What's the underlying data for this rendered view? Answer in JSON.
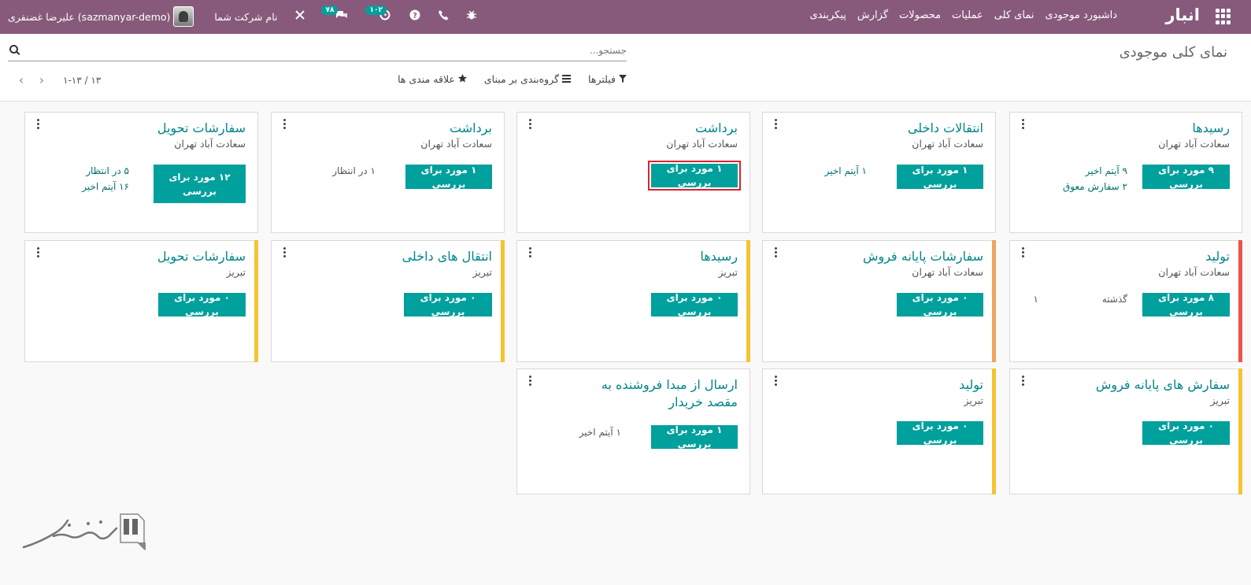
{
  "navbar": {
    "brand": "انبار",
    "menu": [
      "داشبورد موجودی",
      "نمای کلی",
      "عملیات",
      "محصولات",
      "گزارش",
      "پیکربندی"
    ],
    "user_name": "علیرضا غضنفری (sazmanyar-demo)",
    "company": "نام شرکت شما",
    "activity_count": "۱۰۲",
    "messages_count": "۷۸"
  },
  "control": {
    "breadcrumb": "نمای کلی موجودی",
    "search_placeholder": "جستجو...",
    "filters_label": "فیلترها",
    "groupby_label": "گروه‌بندی بر مبنای",
    "favorites_label": "علاقه مندی ها",
    "pager_value": "۱-۱۳ / ۱۳"
  },
  "cards": [
    {
      "title": "رسیدها",
      "subtitle": "سعادت آباد تهران",
      "button": "۹ مورد برای بررسی",
      "stats": [
        "۹ آیتم اخیر",
        "۲ سفارش معوق"
      ],
      "stripe": ""
    },
    {
      "title": "انتقالات داخلی",
      "subtitle": "سعادت آباد تهران",
      "button": "۱ مورد برای بررسی",
      "stats": [
        "۱ آیتم اخیر"
      ],
      "stripe": ""
    },
    {
      "title": "برداشت",
      "subtitle": "سعادت آباد تهران",
      "button": "۱ مورد برای بررسی",
      "stats": [],
      "stripe": "",
      "highlight": true
    },
    {
      "title": "برداشت",
      "subtitle": "سعادت آباد تهران",
      "button": "۱ مورد برای بررسی",
      "stats": [
        "۱ در انتظار"
      ],
      "stripe": ""
    },
    {
      "title": "سفارشات تحویل",
      "subtitle": "سعادت آباد تهران",
      "button": "۱۲ مورد برای بررسی",
      "stats": [
        "۵ در انتظار",
        "۱۶ آیتم اخیر"
      ],
      "stripe": ""
    },
    {
      "title": "تولید",
      "subtitle": "سعادت آباد تهران",
      "button": "۸ مورد برای بررسی",
      "stats": [
        "گذشته",
        "۱"
      ],
      "stripe": "#e9564e"
    },
    {
      "title": "سفارشات پایانه فروش",
      "subtitle": "سعادت آباد تهران",
      "button": "۰ مورد برای بررسی",
      "stats": [],
      "stripe": "#f0a35c"
    },
    {
      "title": "رسیدها",
      "subtitle": "تبریز",
      "button": "۰ مورد برای بررسی",
      "stats": [],
      "stripe": "#f4c431"
    },
    {
      "title": "انتقال های داخلی",
      "subtitle": "تبریز",
      "button": "۰ مورد برای بررسی",
      "stats": [],
      "stripe": "#f4c431"
    },
    {
      "title": "سفارشات تحویل",
      "subtitle": "تبریز",
      "button": "۰ مورد برای بررسی",
      "stats": [],
      "stripe": "#f4c431"
    },
    {
      "title": "سفارش های پایانه فروش",
      "subtitle": "تبریز",
      "button": "۰ مورد برای بررسی",
      "stats": [],
      "stripe": "#f4c431"
    },
    {
      "title": "تولید",
      "subtitle": "تبریز",
      "button": "۰ مورد برای بررسی",
      "stats": [],
      "stripe": "#f4c431"
    },
    {
      "title": "ارسال از مبدا فروشنده به مقصد خریدار",
      "subtitle": "",
      "button": "۱ مورد برای بررسی",
      "stats": [
        "۱ آیتم اخیر"
      ],
      "stripe": ""
    }
  ],
  "icons": {
    "apps": "apps-grid-icon",
    "bug": "bug-icon",
    "phone": "phone-icon",
    "help": "help-icon",
    "activity": "clock-icon",
    "chat": "chat-icon",
    "tools": "tools-icon",
    "search": "search-icon",
    "filter": "filter-icon",
    "groupby": "list-icon",
    "favorite": "star-icon",
    "prev": "chevron-left-icon",
    "next": "chevron-right-icon",
    "kebab": "kebab-icon"
  },
  "colors": {
    "navbar": "#875a7b",
    "accent": "#00a09d",
    "title": "#00858a",
    "highlight": "#d9232d"
  }
}
